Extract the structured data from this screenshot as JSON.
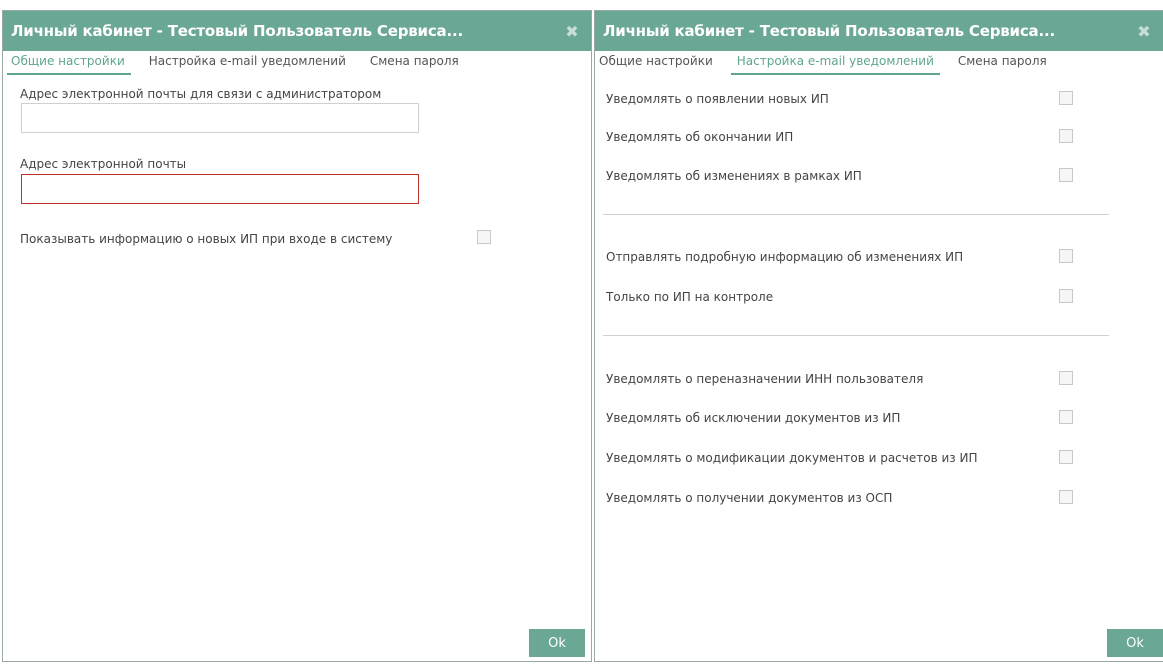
{
  "left_dialog": {
    "title": "Личный кабинет - Тестовый Пользователь Сервиса...",
    "close_icon": "✖",
    "tabs": [
      {
        "label": "Общие настройки",
        "active": true
      },
      {
        "label": "Настройка e-mail уведомлений",
        "active": false
      },
      {
        "label": "Смена пароля",
        "active": false
      }
    ],
    "admin_email_label": "Адрес электронной почты для связи с администратором",
    "admin_email_value": "",
    "email_label": "Адрес электронной почты",
    "email_value": "",
    "show_info_label": "Показывать информацию о новых ИП при входе в систему",
    "show_info_checked": false,
    "ok_label": "Ok"
  },
  "right_dialog": {
    "title": "Личный кабинет - Тестовый Пользователь Сервиса...",
    "close_icon": "✖",
    "tabs": [
      {
        "label": "Общие настройки",
        "active": false
      },
      {
        "label": "Настройка e-mail уведомлений",
        "active": true
      },
      {
        "label": "Смена пароля",
        "active": false
      }
    ],
    "group1": [
      {
        "label": "Уведомлять о появлении новых ИП",
        "checked": false
      },
      {
        "label": "Уведомлять об окончании ИП",
        "checked": false
      },
      {
        "label": "Уведомлять об изменениях в рамках ИП",
        "checked": false
      }
    ],
    "group2": [
      {
        "label": "Отправлять подробную информацию об изменениях ИП",
        "checked": false
      },
      {
        "label": "Только по ИП на контроле",
        "checked": false
      }
    ],
    "group3": [
      {
        "label": "Уведомлять о переназначении ИНН пользователя",
        "checked": false
      },
      {
        "label": "Уведомлять об исключении документов из ИП",
        "checked": false
      },
      {
        "label": "Уведомлять о модификации документов и расчетов из ИП",
        "checked": false
      },
      {
        "label": "Уведомлять о получении документов из ОСП",
        "checked": false
      }
    ],
    "ok_label": "Ok"
  },
  "colors": {
    "accent": "#6aa795",
    "active_tab": "#5fa58f",
    "invalid_border": "#c0332c"
  }
}
